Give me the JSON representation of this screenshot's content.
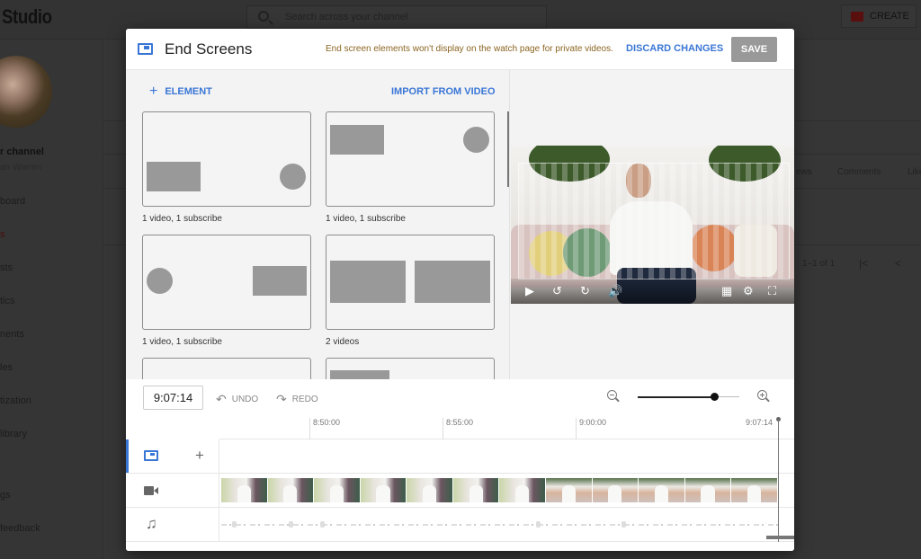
{
  "background": {
    "logo": "Studio",
    "search_placeholder": "Search across your channel",
    "create_label": "CREATE",
    "channel_label": "r channel",
    "channel_owner": "an Warren",
    "nav": [
      "board",
      "s",
      "sts",
      "tics",
      "nents",
      "les",
      "tization",
      "library",
      "gs",
      "feedback"
    ],
    "active_nav_index": 1,
    "table_columns": [
      "ews",
      "Comments",
      "Like"
    ],
    "pagination": "1–1 of 1"
  },
  "modal": {
    "title": "End Screens",
    "title_icon": "end-screen-icon",
    "warning": "End screen elements won't display on the watch page for private videos.",
    "discard_label": "DISCARD CHANGES",
    "save_label": "SAVE",
    "add_element_label": "ELEMENT",
    "import_label": "IMPORT FROM VIDEO",
    "templates": [
      {
        "label": "1 video, 1 subscribe"
      },
      {
        "label": "1 video, 1 subscribe"
      },
      {
        "label": "1 video, 1 subscribe"
      },
      {
        "label": "2 videos"
      },
      {
        "label": ""
      },
      {
        "label": ""
      }
    ],
    "player_controls": [
      "play-icon",
      "rewind-10-icon",
      "forward-10-icon",
      "volume-icon",
      "grid-icon",
      "settings-icon",
      "fullscreen-icon"
    ]
  },
  "timeline": {
    "current_time": "9:07:14",
    "undo_label": "UNDO",
    "redo_label": "REDO",
    "zoom_level": 0.76,
    "ticks": [
      "8:50:00",
      "8:55:00",
      "9:00:00",
      "9:07:14"
    ],
    "tracks": [
      "end-screen-track",
      "video-track",
      "audio-track"
    ],
    "frame_count": 12
  },
  "colors": {
    "accent": "#3a76d6",
    "warning": "#8a6420",
    "save_disabled": "#999999"
  }
}
